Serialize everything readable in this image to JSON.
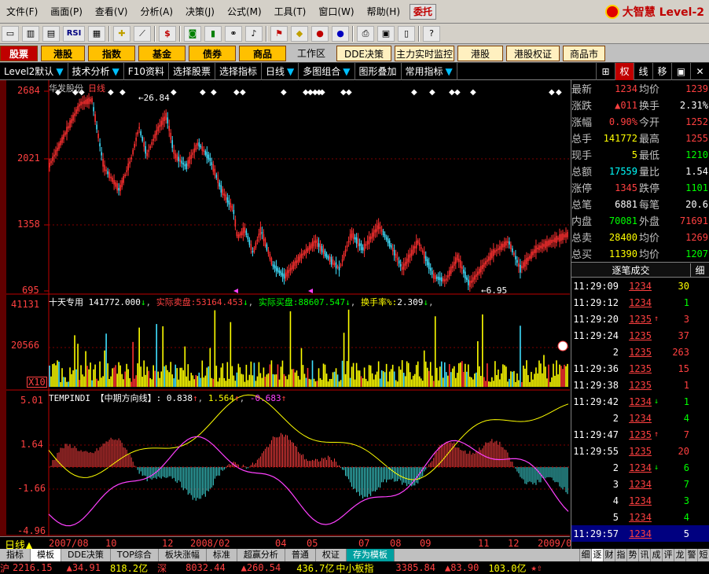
{
  "menu": {
    "items": [
      "文件(F)",
      "画面(P)",
      "查看(V)",
      "分析(A)",
      "决策(J)",
      "公式(M)",
      "工具(T)",
      "窗口(W)",
      "帮助(H)"
    ],
    "entrust": "委托",
    "brand": "大智慧 Level-2"
  },
  "toolbar": {
    "rsi_label": "RSI"
  },
  "nav": {
    "stocks": "股票",
    "hk": "港股",
    "index": "指数",
    "fund": "基金",
    "bond": "债券",
    "commodity": "商品",
    "workspace": "工作区",
    "dde": "DDE决策",
    "monitor": "主力实时监控",
    "hk2": "港股",
    "hk_warrant": "港股权证",
    "commodity_market": "商品市"
  },
  "subbar": {
    "level2": "Level2默认",
    "tech": "技术分析",
    "f10": "F10资料",
    "pick": "选择股票",
    "pick_index": "选择指标",
    "kline": "日线",
    "multi": "多图组合",
    "overlay": "图形叠加",
    "common": "常用指标",
    "right_buttons": [
      "权",
      "线",
      "移"
    ]
  },
  "chart": {
    "stock_name": "华发股份",
    "period": "日线",
    "price_axis": [
      "2684",
      "2021",
      "1358",
      "695"
    ],
    "high_marker": "26.84",
    "low_marker": "6.95",
    "vol_panel": {
      "title": "十天专用",
      "total": "141772.000",
      "sell_label": "实际卖盘:",
      "sell_value": "53164.453",
      "buy_label": "实际买盘:",
      "buy_value": "88607.547",
      "turn_label": "换手率%:",
      "turn_value": "2.309",
      "axis": [
        "41131",
        "20566"
      ],
      "unit": "X10"
    },
    "ind_panel": {
      "name": "TEMPINDI",
      "title": "【中期方向线】:",
      "v1": "0.838",
      "v2": "1.564",
      "v3": "-0.683",
      "axis": [
        "5.01",
        "1.64",
        "-1.66",
        "-4.96"
      ]
    },
    "dates": [
      "2007/08",
      "10",
      "12",
      "2008/02",
      "04",
      "05",
      "07",
      "08",
      "09",
      "11",
      "12",
      "2009/0"
    ]
  },
  "quote": {
    "rows": [
      {
        "l1": "最新",
        "v1": "1234",
        "c1": "red",
        "l2": "均价",
        "v2": "1239",
        "c2": "red"
      },
      {
        "l1": "涨跌",
        "v1": "▲011",
        "c1": "red",
        "l2": "换手",
        "v2": "2.31%",
        "c2": "wht"
      },
      {
        "l1": "涨幅",
        "v1": "0.90%",
        "c1": "red",
        "l2": "今开",
        "v2": "1252",
        "c2": "red"
      },
      {
        "l1": "总手",
        "v1": "141772",
        "c1": "yel",
        "l2": "最高",
        "v2": "1255",
        "c2": "red"
      },
      {
        "l1": "现手",
        "v1": "5",
        "c1": "yel",
        "l2": "最低",
        "v2": "1210",
        "c2": "grn"
      },
      {
        "l1": "总额",
        "v1": "17559",
        "c1": "cyn",
        "l2": "量比",
        "v2": "1.54",
        "c2": "wht"
      },
      {
        "l1": "涨停",
        "v1": "1345",
        "c1": "red",
        "l2": "跌停",
        "v2": "1101",
        "c2": "grn"
      },
      {
        "l1": "总笔",
        "v1": "6881",
        "c1": "wht",
        "l2": "每笔",
        "v2": "20.6",
        "c2": "wht"
      },
      {
        "l1": "内盘",
        "v1": "70081",
        "c1": "grn",
        "l2": "外盘",
        "v2": "71691",
        "c2": "red"
      },
      {
        "l1": "总卖",
        "v1": "28400",
        "c1": "yel",
        "l2": "均价",
        "v2": "1269",
        "c2": "red"
      },
      {
        "l1": "总买",
        "v1": "11390",
        "c1": "yel",
        "l2": "均价",
        "v2": "1207",
        "c2": "grn"
      }
    ],
    "ticks_header": "逐笔成交",
    "ticks_detail": "细",
    "ticks": [
      {
        "time": "11:29:09",
        "price": "1234",
        "pc": "red",
        "arrow": "",
        "ac": "",
        "vol": "30",
        "vc": "yel"
      },
      {
        "time": "11:29:12",
        "price": "1234",
        "pc": "red",
        "arrow": "",
        "ac": "",
        "vol": "1",
        "vc": "grn"
      },
      {
        "time": "11:29:20",
        "price": "1235",
        "pc": "red",
        "arrow": "↑",
        "ac": "red",
        "vol": "3",
        "vc": "red"
      },
      {
        "time": "11:29:24",
        "price": "1235",
        "pc": "red",
        "arrow": "",
        "ac": "",
        "vol": "37",
        "vc": "red"
      },
      {
        "time": "2",
        "price": "1235",
        "pc": "red",
        "arrow": "",
        "ac": "",
        "vol": "263",
        "vc": "red"
      },
      {
        "time": "11:29:36",
        "price": "1235",
        "pc": "red",
        "arrow": "",
        "ac": "",
        "vol": "15",
        "vc": "red"
      },
      {
        "time": "11:29:38",
        "price": "1235",
        "pc": "red",
        "arrow": "",
        "ac": "",
        "vol": "1",
        "vc": "red"
      },
      {
        "time": "11:29:42",
        "price": "1234",
        "pc": "red",
        "arrow": "↓",
        "ac": "grn",
        "vol": "1",
        "vc": "grn"
      },
      {
        "time": "2",
        "price": "1234",
        "pc": "red",
        "arrow": "",
        "ac": "",
        "vol": "4",
        "vc": "grn"
      },
      {
        "time": "11:29:47",
        "price": "1235",
        "pc": "red",
        "arrow": "↑",
        "ac": "red",
        "vol": "7",
        "vc": "red"
      },
      {
        "time": "11:29:55",
        "price": "1235",
        "pc": "red",
        "arrow": "",
        "ac": "",
        "vol": "20",
        "vc": "red"
      },
      {
        "time": "2",
        "price": "1234",
        "pc": "red",
        "arrow": "↓",
        "ac": "grn",
        "vol": "6",
        "vc": "grn"
      },
      {
        "time": "3",
        "price": "1234",
        "pc": "red",
        "arrow": "",
        "ac": "",
        "vol": "7",
        "vc": "grn"
      },
      {
        "time": "4",
        "price": "1234",
        "pc": "red",
        "arrow": "",
        "ac": "",
        "vol": "3",
        "vc": "grn"
      },
      {
        "time": "5",
        "price": "1234",
        "pc": "red",
        "arrow": "",
        "ac": "",
        "vol": "4",
        "vc": "grn"
      },
      {
        "time": "11:29:57",
        "price": "1234",
        "pc": "red",
        "arrow": "",
        "ac": "",
        "vol": "5",
        "vc": "wht"
      }
    ]
  },
  "tabs": {
    "items": [
      "指标",
      "模板",
      "DDE决策",
      "TOP综合",
      "板块涨幅",
      "标准",
      "超赢分析",
      "普通",
      "权证",
      "存为模板"
    ],
    "right": [
      "细",
      "逐",
      "财",
      "指",
      "势",
      "讯",
      "成",
      "评",
      "龙",
      "警",
      "短"
    ]
  },
  "status": {
    "sh_label": "沪",
    "sh_index": "2216.15",
    "sh_change": "▲34.91",
    "sh_amount": "818.2亿",
    "sz_label": "深",
    "sz_index": "8032.44",
    "sz_change": "▲260.54",
    "sz_amount": "436.7亿",
    "sme_label": "中小板指",
    "sme_index": "3385.84",
    "sme_change": "▲83.90",
    "sme_amount": "103.0亿"
  }
}
